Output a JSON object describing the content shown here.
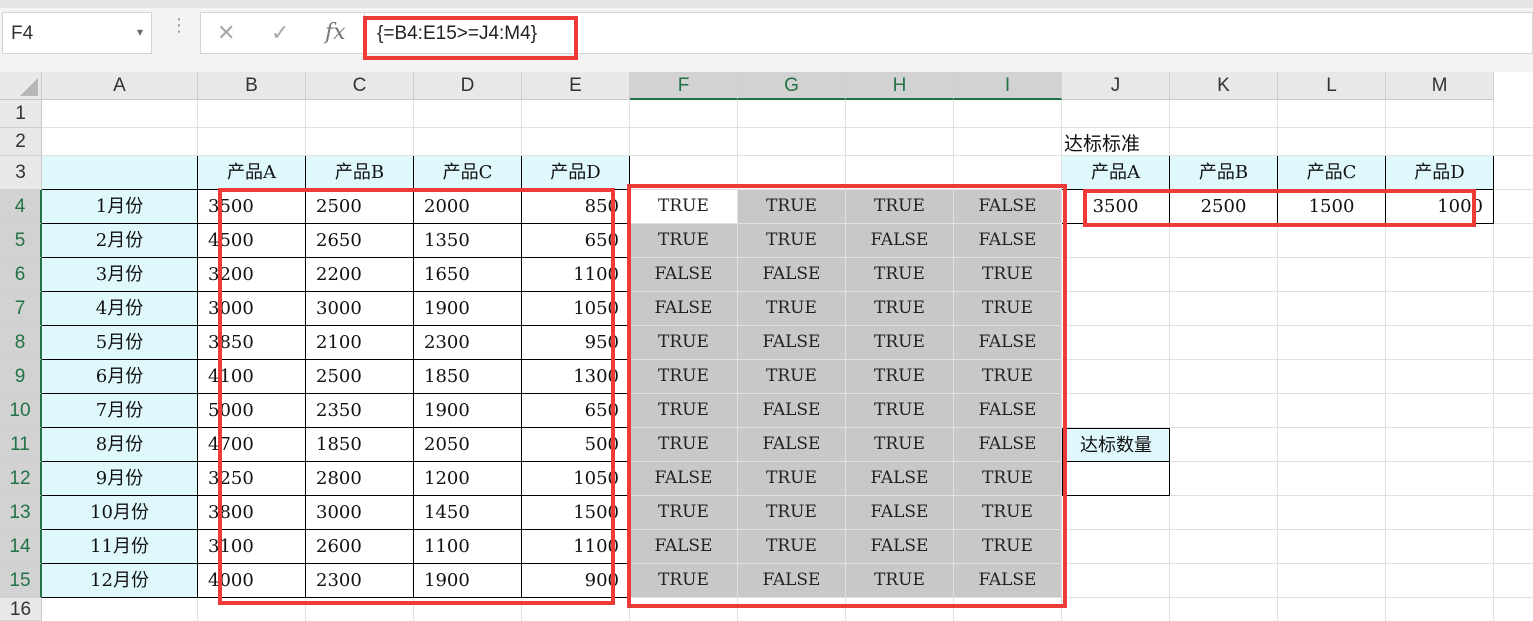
{
  "formula_bar": {
    "name_box": "F4",
    "cancel_icon": "✕",
    "enter_icon": "✓",
    "fx_label": "fx",
    "formula": "{=B4:E15>=J4:M4}"
  },
  "columns": [
    "A",
    "B",
    "C",
    "D",
    "E",
    "F",
    "G",
    "H",
    "I",
    "J",
    "K",
    "L",
    "M"
  ],
  "selected_columns": [
    "F",
    "G",
    "H",
    "I"
  ],
  "rows": [
    "1",
    "2",
    "3",
    "4",
    "5",
    "6",
    "7",
    "8",
    "9",
    "10",
    "11",
    "12",
    "13",
    "14",
    "15",
    "16"
  ],
  "selected_rows": [
    "4",
    "5",
    "6",
    "7",
    "8",
    "9",
    "10",
    "11",
    "12",
    "13",
    "14",
    "15"
  ],
  "table": {
    "headers": [
      "产品A",
      "产品B",
      "产品C",
      "产品D"
    ],
    "months": [
      "1月份",
      "2月份",
      "3月份",
      "4月份",
      "5月份",
      "6月份",
      "7月份",
      "8月份",
      "9月份",
      "10月份",
      "11月份",
      "12月份"
    ],
    "values": [
      [
        "3500",
        "2500",
        "2000",
        "850"
      ],
      [
        "4500",
        "2650",
        "1350",
        "650"
      ],
      [
        "3200",
        "2200",
        "1650",
        "1100"
      ],
      [
        "3000",
        "3000",
        "1900",
        "1050"
      ],
      [
        "3850",
        "2100",
        "2300",
        "950"
      ],
      [
        "4100",
        "2500",
        "1850",
        "1300"
      ],
      [
        "5000",
        "2350",
        "1900",
        "650"
      ],
      [
        "4700",
        "1850",
        "2050",
        "500"
      ],
      [
        "3250",
        "2800",
        "1200",
        "1050"
      ],
      [
        "3800",
        "3000",
        "1450",
        "1500"
      ],
      [
        "3100",
        "2600",
        "1100",
        "1100"
      ],
      [
        "4000",
        "2300",
        "1900",
        "900"
      ]
    ]
  },
  "results": [
    [
      "TRUE",
      "TRUE",
      "TRUE",
      "FALSE"
    ],
    [
      "TRUE",
      "TRUE",
      "FALSE",
      "FALSE"
    ],
    [
      "FALSE",
      "FALSE",
      "TRUE",
      "TRUE"
    ],
    [
      "FALSE",
      "TRUE",
      "TRUE",
      "TRUE"
    ],
    [
      "TRUE",
      "FALSE",
      "TRUE",
      "FALSE"
    ],
    [
      "TRUE",
      "TRUE",
      "TRUE",
      "TRUE"
    ],
    [
      "TRUE",
      "FALSE",
      "TRUE",
      "FALSE"
    ],
    [
      "TRUE",
      "FALSE",
      "TRUE",
      "FALSE"
    ],
    [
      "FALSE",
      "TRUE",
      "FALSE",
      "TRUE"
    ],
    [
      "TRUE",
      "TRUE",
      "FALSE",
      "TRUE"
    ],
    [
      "FALSE",
      "TRUE",
      "FALSE",
      "TRUE"
    ],
    [
      "TRUE",
      "FALSE",
      "TRUE",
      "FALSE"
    ]
  ],
  "standard": {
    "title": "达标标准",
    "headers": [
      "产品A",
      "产品B",
      "产品C",
      "产品D"
    ],
    "values": [
      "3500",
      "2500",
      "1500",
      "1000"
    ]
  },
  "count": {
    "label": "达标数量",
    "value": ""
  },
  "colors": {
    "highlight_red": "#ef3a3a",
    "header_cyan": "#dff8fb",
    "result_gray": "#c8c8c8",
    "excel_green": "#217346"
  }
}
